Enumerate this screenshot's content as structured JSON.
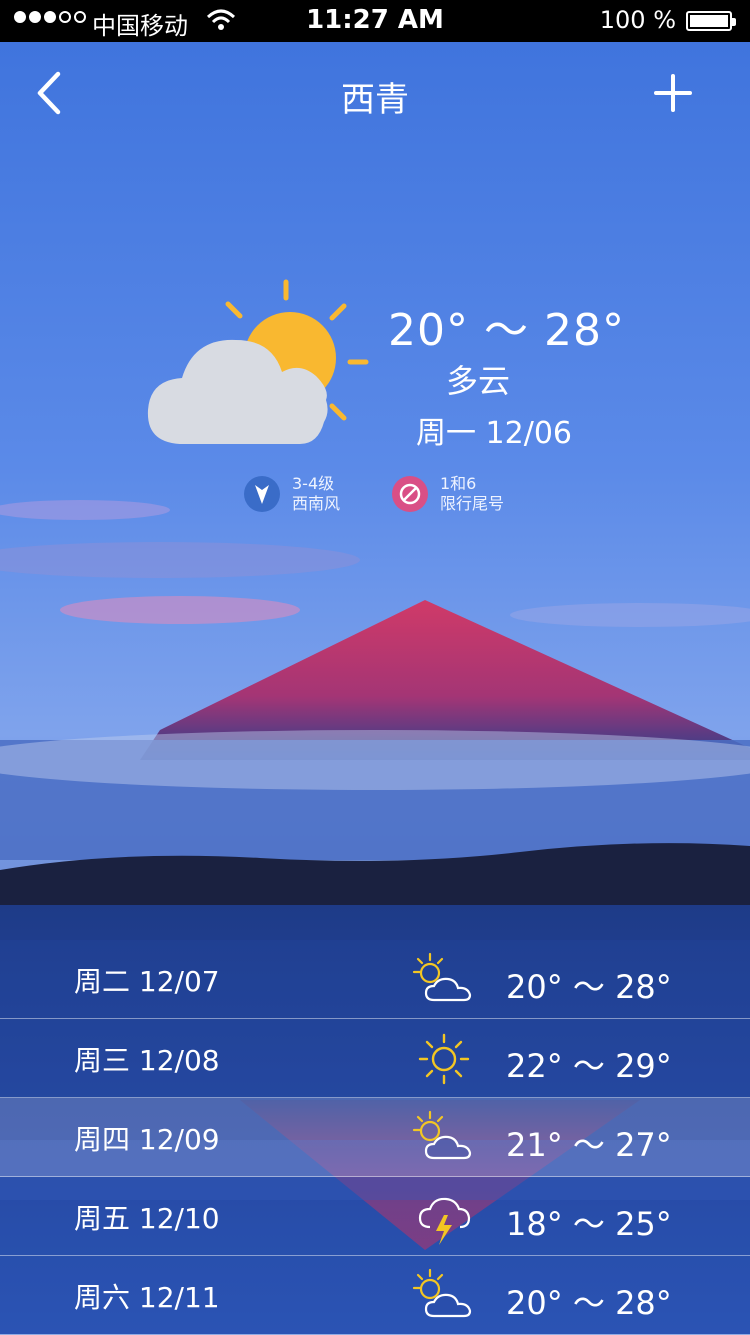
{
  "status_bar": {
    "carrier": "中国移动",
    "time": "11:27 AM",
    "battery": "100 %"
  },
  "header": {
    "title": "西青"
  },
  "today": {
    "temp_range": "20° ～ 28°",
    "condition": "多云",
    "date": "周一  12/06",
    "icon": "partly-cloudy-icon",
    "wind": {
      "level": "3-4级",
      "direction": "西南风",
      "icon": "wind-direction-icon"
    },
    "restriction": {
      "numbers": "1和6",
      "label": "限行尾号",
      "icon": "no-entry-icon"
    }
  },
  "forecast": [
    {
      "label": "周二  12/07",
      "icon": "partly-cloudy-icon",
      "temps": "20° ～ 28°"
    },
    {
      "label": "周三  12/08",
      "icon": "sun-icon",
      "temps": "22° ～ 29°"
    },
    {
      "label": "周四  12/09",
      "icon": "partly-cloudy-icon",
      "temps": "21° ～ 27°"
    },
    {
      "label": "周五  12/10",
      "icon": "thunderstorm-icon",
      "temps": "18° ～ 25°"
    },
    {
      "label": "周六  12/11",
      "icon": "partly-cloudy-icon",
      "temps": "20° ～ 28°"
    }
  ],
  "colors": {
    "sun": "#f9b830",
    "cloud": "#d8dbe2",
    "wind_badge": "#3a6cc8",
    "restriction_badge": "#d94f86",
    "lightning": "#f3c623"
  }
}
